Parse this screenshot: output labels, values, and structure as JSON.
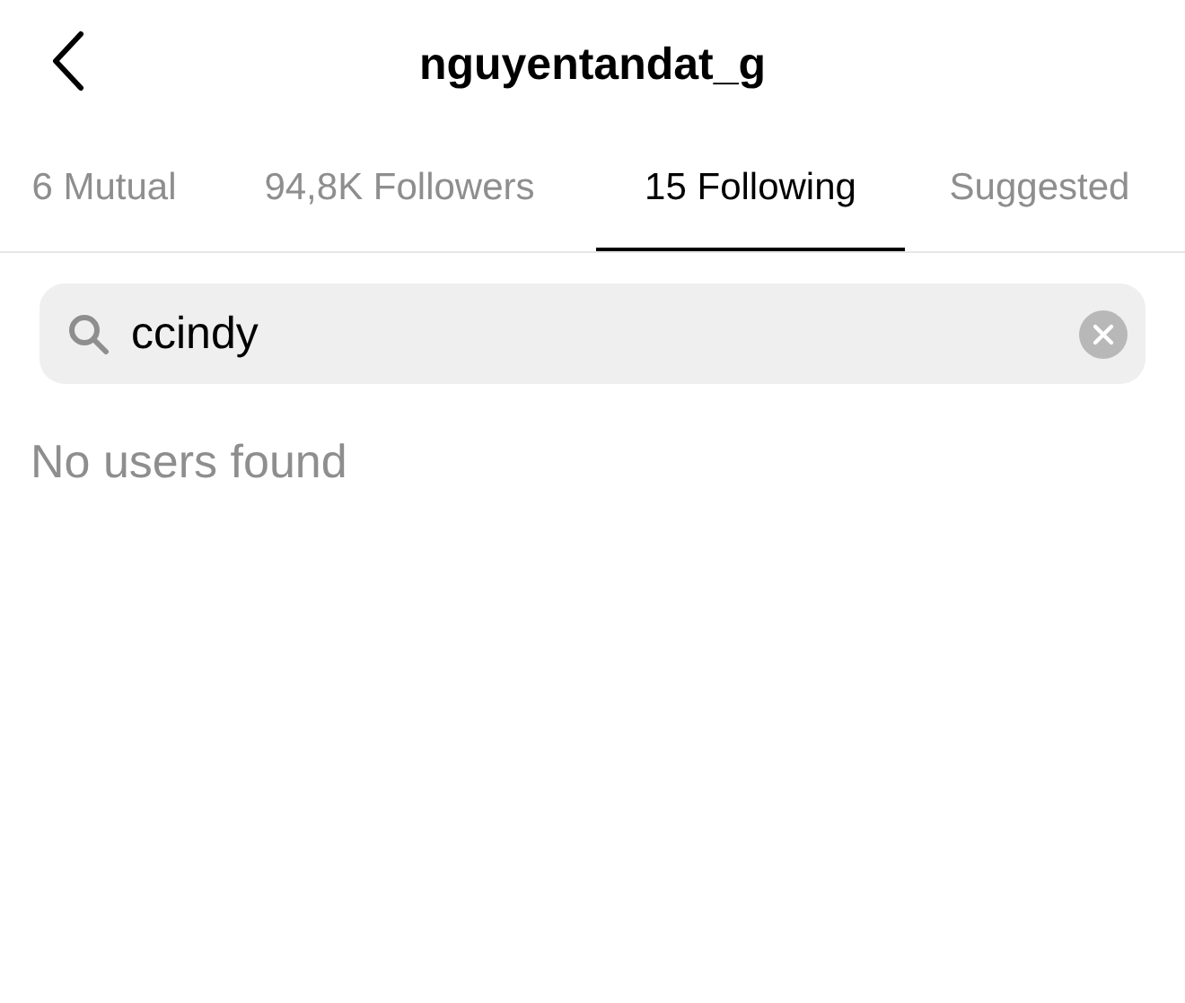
{
  "header": {
    "title": "nguyentandat_g"
  },
  "tabs": [
    {
      "label": "6 Mutual",
      "selected": false
    },
    {
      "label": "94,8K Followers",
      "selected": false
    },
    {
      "label": "15 Following",
      "selected": true
    },
    {
      "label": "Suggested",
      "selected": false
    }
  ],
  "search": {
    "value": "ccindy"
  },
  "empty_message": "No users found"
}
